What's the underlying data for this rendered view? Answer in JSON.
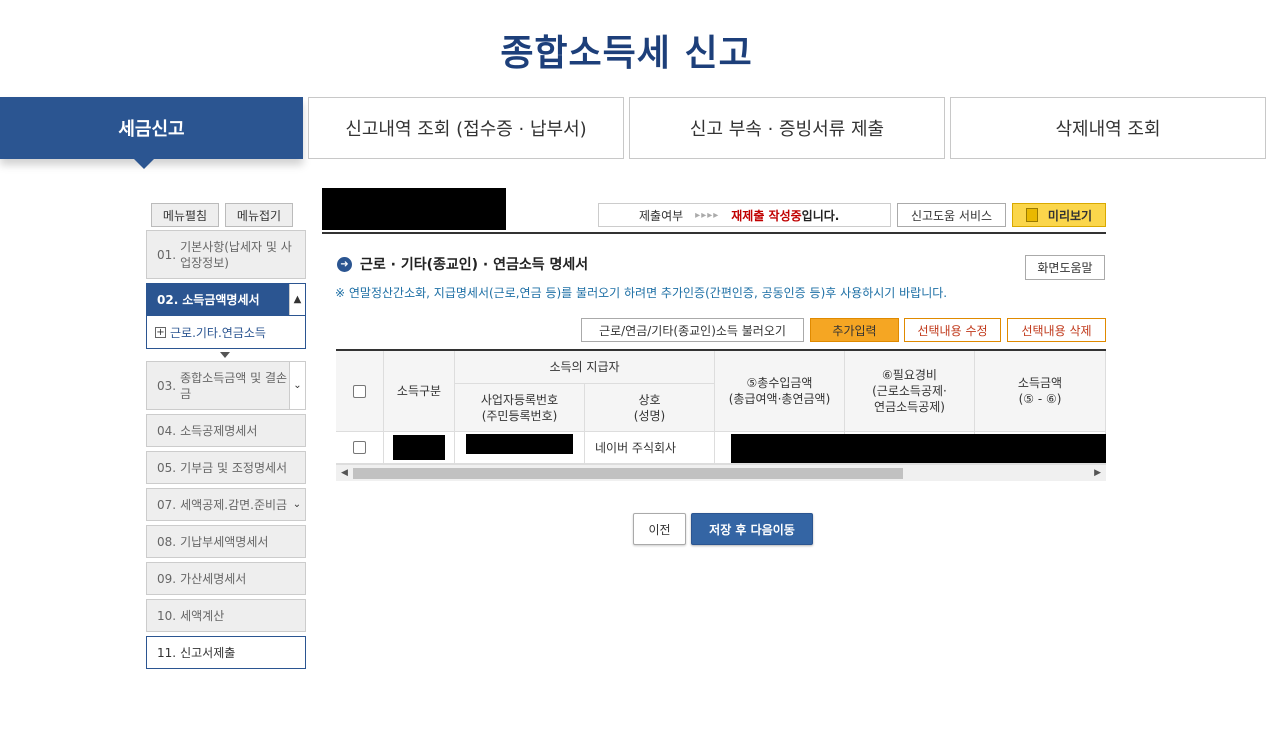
{
  "page": {
    "title": "종합소득세 신고"
  },
  "tabs": [
    {
      "label": "세금신고",
      "active": true
    },
    {
      "label": "신고내역 조회 (접수증 · 납부서)"
    },
    {
      "label": "신고 부속 · 증빙서류 제출"
    },
    {
      "label": "삭제내역 조회"
    }
  ],
  "sidebar": {
    "expand_label": "메뉴펼침",
    "collapse_label": "메뉴접기",
    "items": [
      {
        "num": "01.",
        "label": "기본사항(납세자 및 사업장정보)"
      },
      {
        "num": "02.",
        "label": "소득금액명세서"
      },
      {
        "num": "03.",
        "label": "종합소득금액 및 결손금"
      },
      {
        "num": "04.",
        "label": "소득공제명세서"
      },
      {
        "num": "05.",
        "label": "기부금 및 조정명세서"
      },
      {
        "num": "07.",
        "label": "세액공제.감면.준비금"
      },
      {
        "num": "08.",
        "label": "기납부세액명세서"
      },
      {
        "num": "09.",
        "label": "가산세명세서"
      },
      {
        "num": "10.",
        "label": "세액계산"
      },
      {
        "num": "11.",
        "label": "신고서제출"
      }
    ],
    "subitem": {
      "plus": "+",
      "label": "근로.기타.연금소득"
    }
  },
  "status": {
    "prefix": "제출여부",
    "arrows": "▸▸▸▸",
    "highlight": "재제출 작성중",
    "suffix": "입니다."
  },
  "toolbar": {
    "help_service": "신고도움 서비스",
    "preview": "미리보기",
    "screen_help": "화면도움말",
    "load": "근로/연금/기타(종교인)소득 불러오기",
    "add": "추가입력",
    "edit": "선택내용 수정",
    "delete": "선택내용 삭제"
  },
  "section": {
    "title": "근로 · 기타(종교인) · 연금소득 명세서",
    "notice": "※ 연말정산간소화, 지급명세서(근로,연금 등)를 불러오기 하려면 추가인증(간편인증, 공동인증 등)후 사용하시기 바랍니다."
  },
  "grid": {
    "headers": {
      "income_type": "소득구분",
      "payer_group": "소득의 지급자",
      "reg_no_line1": "사업자등록번호",
      "reg_no_line2": "(주민등록번호)",
      "name_line1": "상호",
      "name_line2": "(성명)",
      "gross_line1": "⑤총수입금액",
      "gross_line2": "(총급여액·총연금액)",
      "expense_line1": "⑥필요경비",
      "expense_line2": "(근로소득공제·",
      "expense_line3": "연금소득공제)",
      "income_line1": "소득금액",
      "income_line2": "(⑤ - ⑥)"
    },
    "rows": [
      {
        "company": "네이버 주식회사"
      }
    ]
  },
  "footer": {
    "prev": "이전",
    "save_next": "저장 후 다음이동"
  }
}
